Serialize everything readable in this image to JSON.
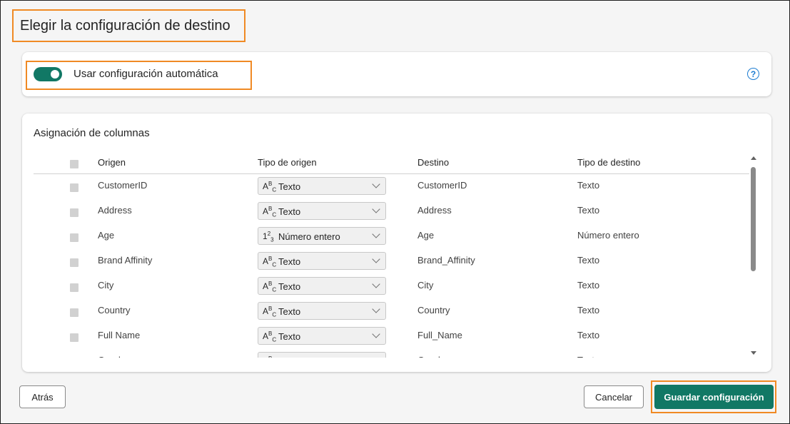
{
  "page": {
    "title": "Elegir la configuración de destino"
  },
  "auto": {
    "label": "Usar configuración automática",
    "toggle_on": true,
    "help_icon": "question-circle-icon"
  },
  "mapping": {
    "title": "Asignación de columnas",
    "columns": [
      "Origen",
      "Tipo de origen",
      "Destino",
      "Tipo de destino"
    ],
    "rows": [
      {
        "source": "CustomerID",
        "source_type_icon": "ABC",
        "source_type": "Texto",
        "dest": "CustomerID",
        "dest_type": "Texto"
      },
      {
        "source": "Address",
        "source_type_icon": "ABC",
        "source_type": "Texto",
        "dest": "Address",
        "dest_type": "Texto"
      },
      {
        "source": "Age",
        "source_type_icon": "123",
        "source_type": "Número entero",
        "dest": "Age",
        "dest_type": "Número entero"
      },
      {
        "source": "Brand Affinity",
        "source_type_icon": "ABC",
        "source_type": "Texto",
        "dest": "Brand_Affinity",
        "dest_type": "Texto"
      },
      {
        "source": "City",
        "source_type_icon": "ABC",
        "source_type": "Texto",
        "dest": "City",
        "dest_type": "Texto"
      },
      {
        "source": "Country",
        "source_type_icon": "ABC",
        "source_type": "Texto",
        "dest": "Country",
        "dest_type": "Texto"
      },
      {
        "source": "Full Name",
        "source_type_icon": "ABC",
        "source_type": "Texto",
        "dest": "Full_Name",
        "dest_type": "Texto"
      },
      {
        "source": "Gender",
        "source_type_icon": "ABC",
        "source_type": "Texto",
        "dest": "Gender",
        "dest_type": "Texto"
      }
    ]
  },
  "footer": {
    "back_label": "Atrás",
    "cancel_label": "Cancelar",
    "save_label": "Guardar configuración"
  },
  "colors": {
    "accent": "#117865",
    "highlight": "#f08a24",
    "help": "#1b7bd1"
  }
}
